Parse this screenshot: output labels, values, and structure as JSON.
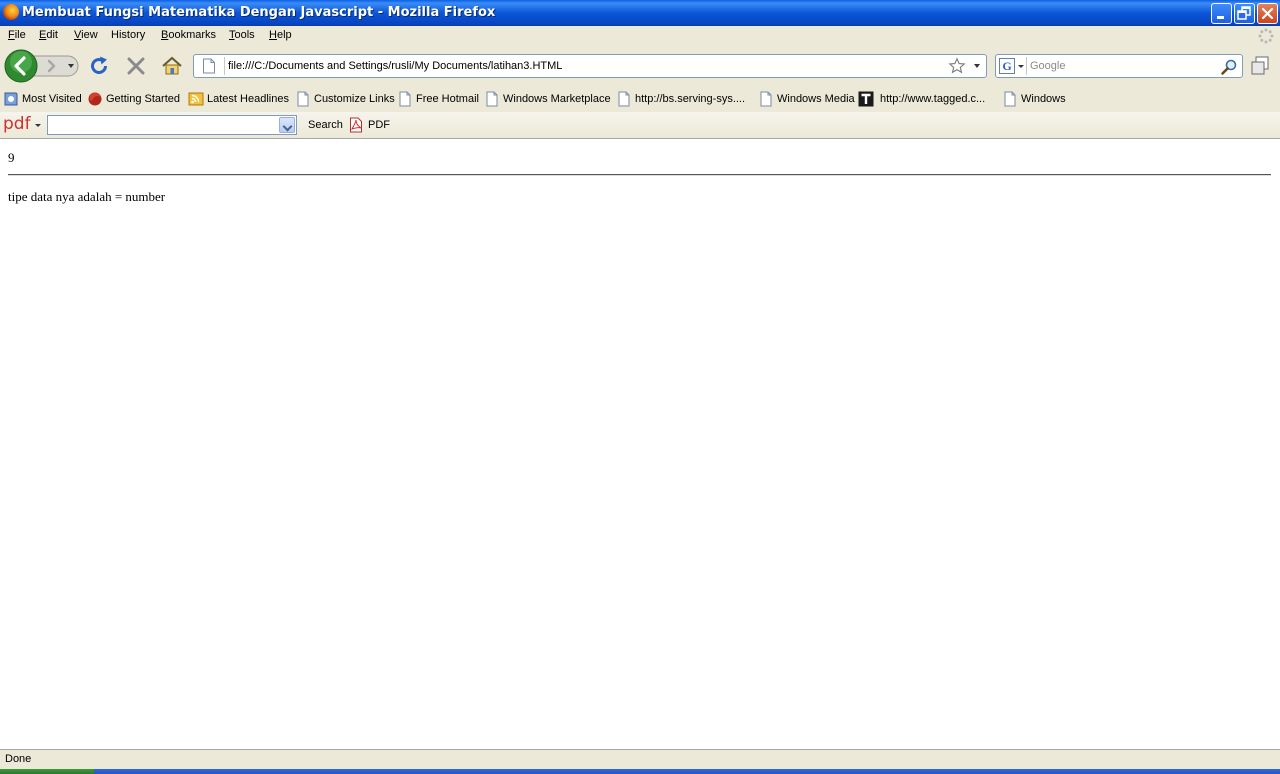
{
  "window": {
    "title": "Membuat Fungsi Matematika Dengan Javascript - Mozilla Firefox"
  },
  "menu": [
    {
      "first": "F",
      "rest": "ile"
    },
    {
      "first": "E",
      "rest": "dit"
    },
    {
      "first": "V",
      "rest": "iew"
    },
    {
      "first": "H",
      "rest": "istory",
      "underline_index": 1
    },
    {
      "first": "B",
      "rest": "ookmarks"
    },
    {
      "first": "T",
      "rest": "ools"
    },
    {
      "first": "H",
      "rest": "elp"
    }
  ],
  "navigation": {
    "url": "file:///C:/Documents and Settings/rusli/My Documents/latihan3.HTML",
    "search_placeholder": "Google",
    "search_engine_letter": "G"
  },
  "bookmarks": [
    {
      "label": "Most Visited",
      "icon": "most-visited-icon"
    },
    {
      "label": "Getting Started",
      "icon": "firefox-icon"
    },
    {
      "label": "Latest Headlines",
      "icon": "rss-icon"
    },
    {
      "label": "Customize Links",
      "icon": "page-icon"
    },
    {
      "label": "Free Hotmail",
      "icon": "page-icon"
    },
    {
      "label": "Windows Marketplace",
      "icon": "page-icon"
    },
    {
      "label": "http://bs.serving-sys....",
      "icon": "page-icon"
    },
    {
      "label": "Windows Media",
      "icon": "page-icon"
    },
    {
      "label": "http://www.tagged.c...",
      "icon": "tagged-icon"
    },
    {
      "label": "Windows",
      "icon": "page-icon"
    }
  ],
  "pdf_toolbar": {
    "logo": "pdf",
    "search_label": "Search",
    "pdf_label": "PDF",
    "query": ""
  },
  "content": {
    "result": "9",
    "type_line": "tipe data nya adalah = number"
  },
  "status": {
    "text": "Done"
  },
  "colors": {
    "titlebar": "#0a56d8",
    "chrome": "#ece9d8",
    "pdf_red": "#d2302a"
  }
}
